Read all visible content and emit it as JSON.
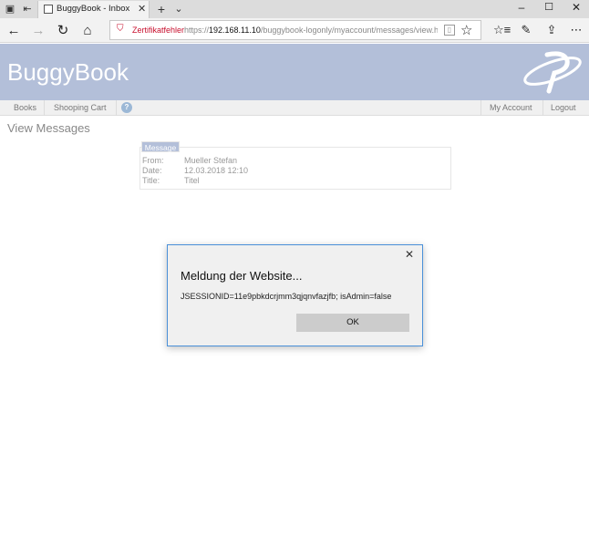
{
  "browser": {
    "tab_title": "BuggyBook - Inbox",
    "cert_warning": "Zertifikatfehler",
    "url_prefix": "https://",
    "url_host": "192.168.11.10",
    "url_path": "/buggybook-logonly/myaccount/messages/view.html?id",
    "icons": [
      "tab-preview-icon",
      "set-aside-icon",
      "close-icon",
      "new-tab-icon",
      "tab-list-icon",
      "minimize-icon",
      "maximize-icon",
      "back-icon",
      "forward-icon",
      "refresh-icon",
      "home-icon",
      "shield-warning-icon",
      "reading-view-icon",
      "favorite-star-icon",
      "favorites-hub-icon",
      "pen-icon",
      "share-icon",
      "more-icon"
    ]
  },
  "app": {
    "brand": "BuggyBook",
    "brand_color": "#b3bfd9",
    "menu": {
      "books": "Books",
      "shopping_cart": "Shooping Cart",
      "help": "?",
      "my_account": "My Account",
      "logout": "Logout"
    }
  },
  "main": {
    "title": "View Messages",
    "message": {
      "tab_label": "Message",
      "from_label": "From:",
      "from_value": "Mueller Stefan",
      "date_label": "Date:",
      "date_value": "12.03.2018 12:10",
      "title_label": "Title:",
      "title_value": "Titel"
    }
  },
  "dialog": {
    "title": "Meldung der Website...",
    "message": "JSESSIONID=11e9pbkdcrjmm3qjqnvfazjfb; isAdmin=false",
    "ok_label": "OK",
    "border_color": "#4a90d9"
  }
}
